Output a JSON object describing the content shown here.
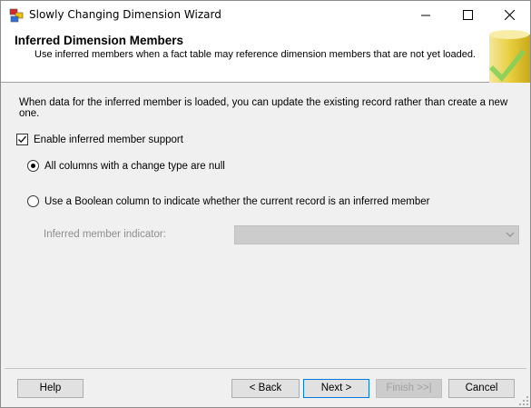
{
  "window": {
    "title": "Slowly Changing Dimension Wizard"
  },
  "banner": {
    "title": "Inferred Dimension Members",
    "subtitle": "Use inferred members when a fact table may reference dimension members that are not yet loaded."
  },
  "content": {
    "description": "When data for the inferred member is loaded, you can update the existing record rather than create a new one.",
    "enable_checkbox": {
      "label": "Enable inferred member support",
      "checked": true
    },
    "options": [
      {
        "label": "All columns with a change type are null",
        "selected": true
      },
      {
        "label": "Use a Boolean column to indicate whether the current record is an inferred member",
        "selected": false
      }
    ],
    "indicator": {
      "label": "Inferred member indicator:",
      "value": "",
      "enabled": false
    }
  },
  "buttons": {
    "help": "Help",
    "back": "< Back",
    "next": "Next >",
    "finish": "Finish >>|",
    "cancel": "Cancel"
  },
  "colors": {
    "accent": "#0078d7",
    "disabled_text": "#8d8d8d"
  }
}
